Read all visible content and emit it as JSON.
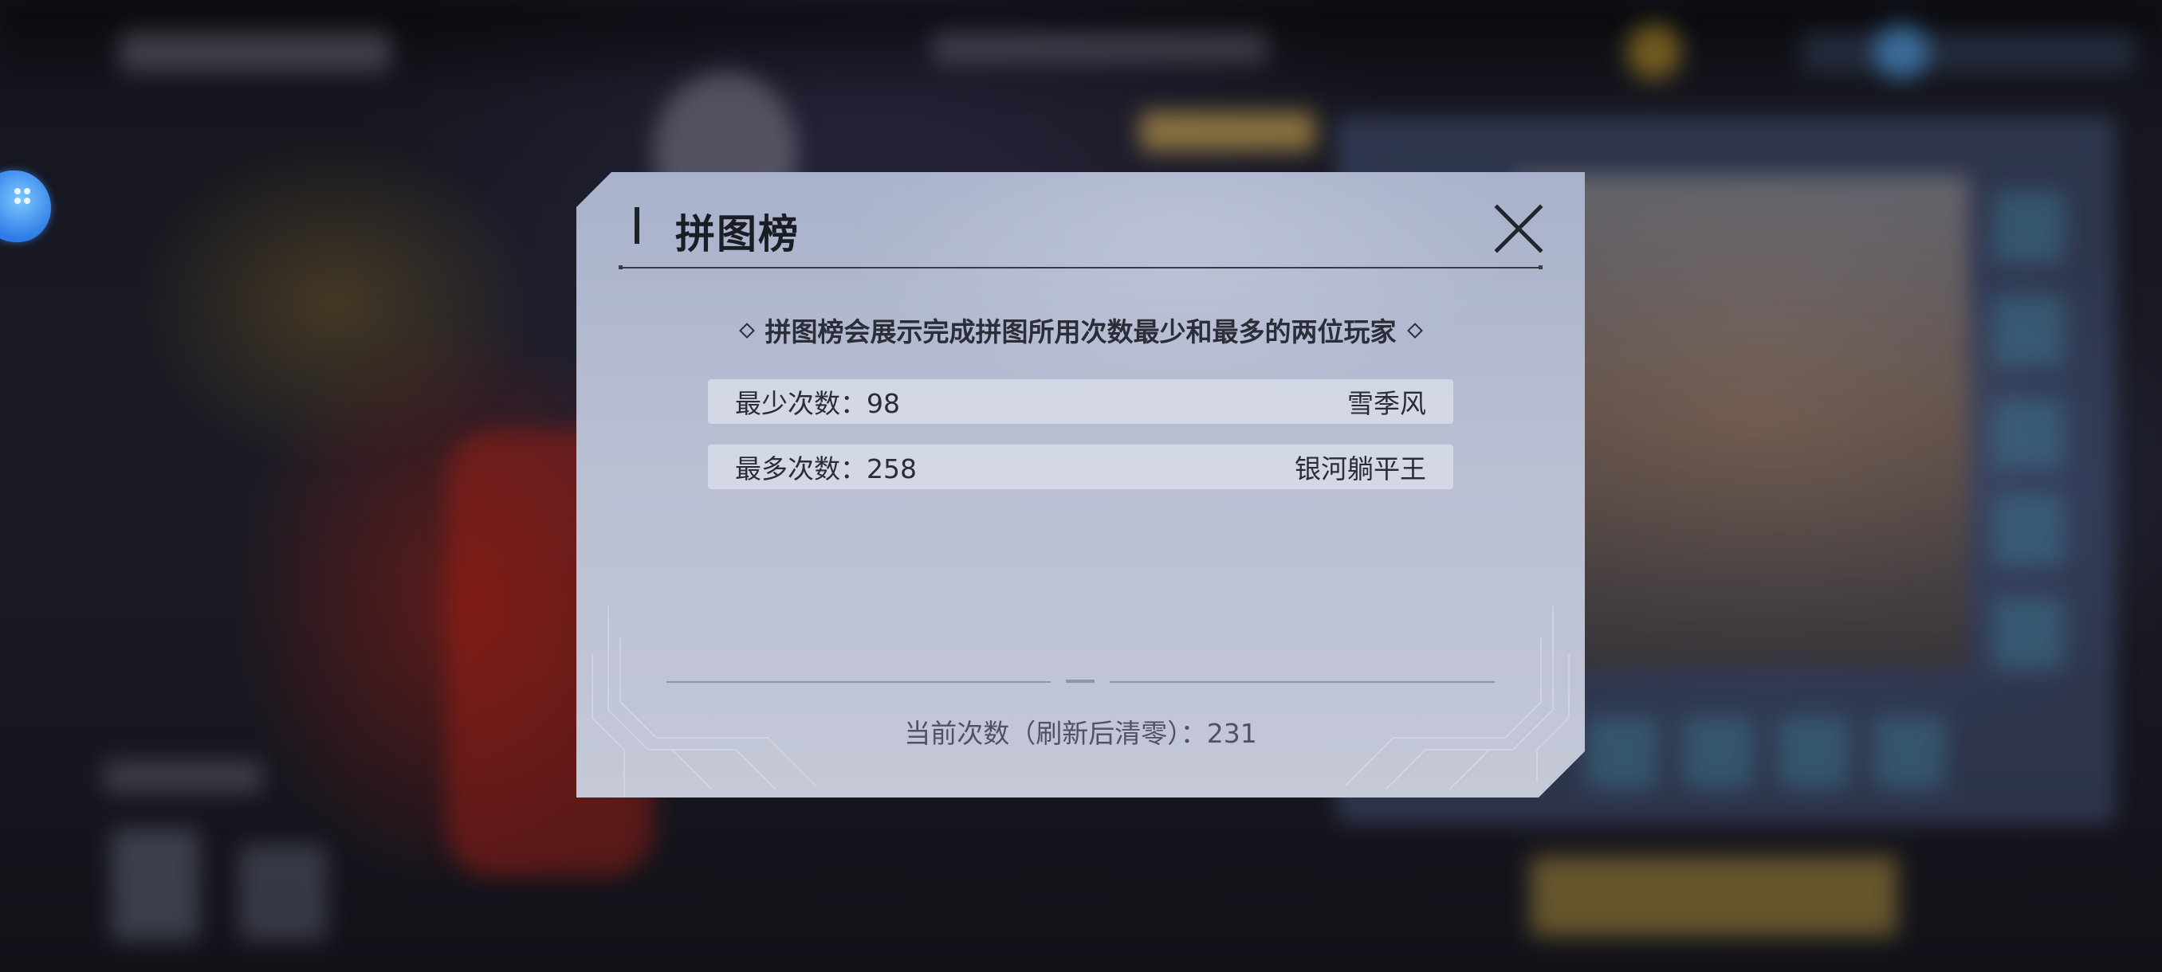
{
  "dialog": {
    "title": "拼图榜",
    "notice": "拼图榜会展示完成拼图所用次数最少和最多的两位玩家",
    "rows": [
      {
        "label": "最少次数：98",
        "player": "雪季风"
      },
      {
        "label": "最多次数：258",
        "player": "银河躺平王"
      }
    ],
    "current_count": "当前次数（刷新后清零）：231"
  },
  "icons": {
    "close": "close-icon",
    "assistant": "floating-assistant-icon"
  },
  "colors": {
    "modal_background": "#b9bfd2",
    "title_text": "#1b1d24",
    "row_background": "#dfe2ec",
    "assistant_blue": "#2e7be8"
  }
}
